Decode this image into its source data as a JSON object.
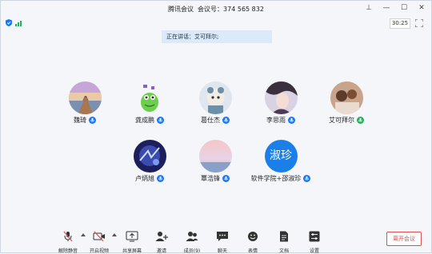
{
  "window": {
    "app_name": "腾讯会议",
    "meeting_label": "会议号：374 565 832"
  },
  "status": {
    "timer": "30:25"
  },
  "speaking_banner": "正在讲话：艾可拜尔;",
  "participants": [
    {
      "name": "魏琦",
      "mic": "blue"
    },
    {
      "name": "龚成鹏",
      "mic": "blue"
    },
    {
      "name": "葛仕杰",
      "mic": "blue"
    },
    {
      "name": "李思雨",
      "mic": "blue"
    },
    {
      "name": "艾可拜尔",
      "mic": "green"
    },
    {
      "name": "卢炳旭",
      "mic": "blue"
    },
    {
      "name": "覃浩锋",
      "mic": "blue"
    },
    {
      "name": "软件学院+邵淑珍",
      "mic": "blue",
      "initials": "淑珍"
    }
  ],
  "toolbar": {
    "unmute": "解除静音",
    "start_video": "开启视频",
    "share_screen": "共享屏幕",
    "invite": "邀请",
    "members": "成员(9)",
    "chat": "聊天",
    "reactions": "表情",
    "docs": "文档",
    "settings": "设置",
    "leave": "离开会议"
  },
  "colors": {
    "accent": "#1677ff",
    "speaking_bg": "#dce9f8",
    "leave_red": "#e04f4f"
  }
}
